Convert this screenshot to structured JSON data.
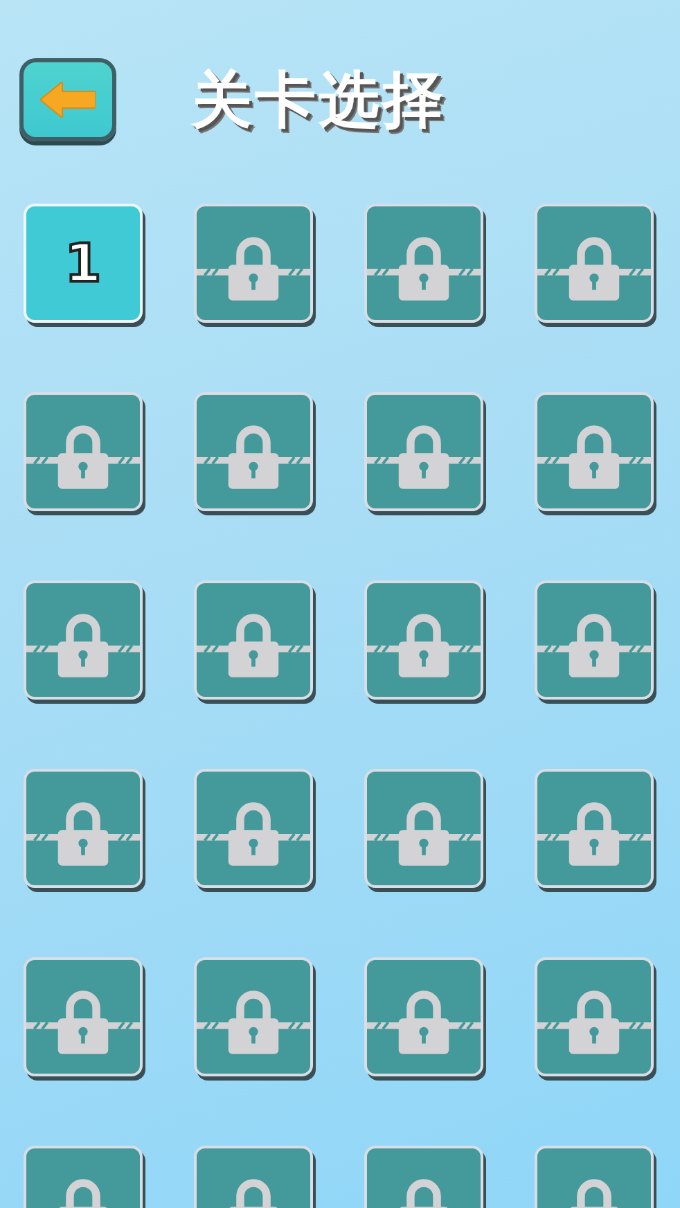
{
  "header": {
    "title": "关卡选择"
  },
  "levels": [
    {
      "locked": false,
      "number": "1"
    },
    {
      "locked": true
    },
    {
      "locked": true
    },
    {
      "locked": true
    },
    {
      "locked": true
    },
    {
      "locked": true
    },
    {
      "locked": true
    },
    {
      "locked": true
    },
    {
      "locked": true
    },
    {
      "locked": true
    },
    {
      "locked": true
    },
    {
      "locked": true
    },
    {
      "locked": true
    },
    {
      "locked": true
    },
    {
      "locked": true
    },
    {
      "locked": true
    },
    {
      "locked": true
    },
    {
      "locked": true
    },
    {
      "locked": true
    },
    {
      "locked": true
    },
    {
      "locked": true
    },
    {
      "locked": true
    },
    {
      "locked": true
    },
    {
      "locked": true
    }
  ]
}
